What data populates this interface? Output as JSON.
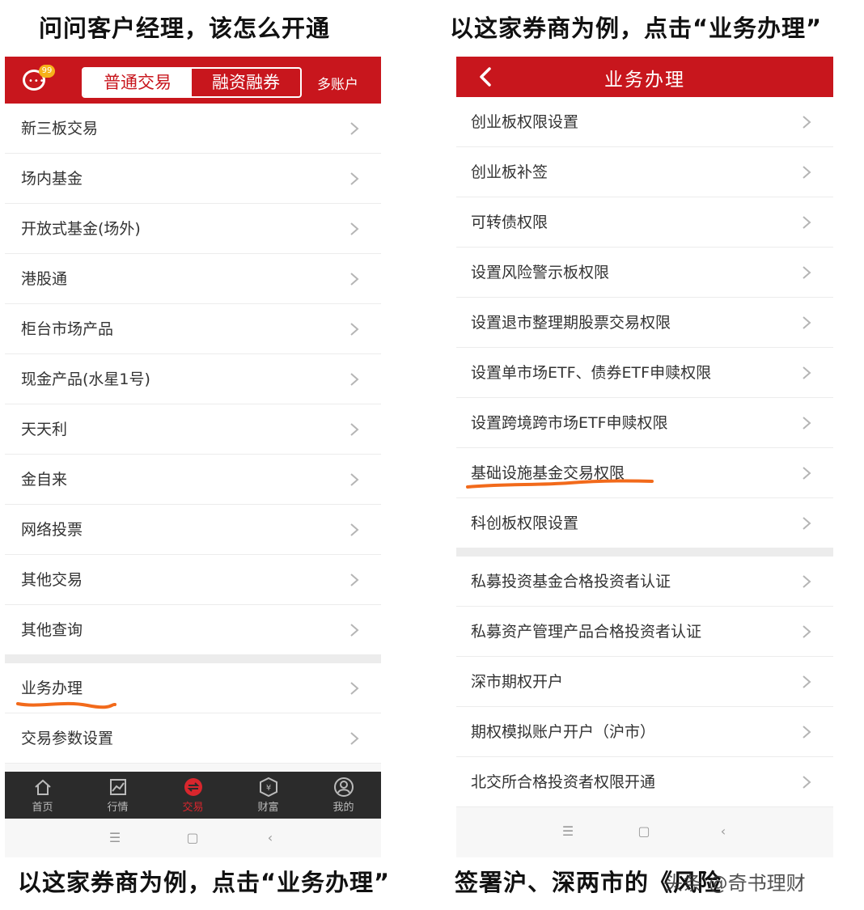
{
  "captions": {
    "top_left": "问问客户经理，该怎么开通",
    "top_right": "以这家券商为例，点击“业务办理”",
    "bottom_left": "以这家券商为例，点击“业务办理”",
    "bottom_right": "签署沪、深两市的《风险"
  },
  "watermark": "头条 @奇书理财",
  "left_screen": {
    "badge_count": "99",
    "segments": [
      "普通交易",
      "融资融券"
    ],
    "active_segment": 0,
    "multi_account": "多账户",
    "menu_group1": [
      "新三板交易",
      "场内基金",
      "开放式基金(场外)",
      "港股通",
      "柜台市场产品",
      "现金产品(水星1号)",
      "天天利",
      "金自来",
      "网络投票",
      "其他交易",
      "其他查询"
    ],
    "menu_group2": [
      "业务办理",
      "交易参数设置"
    ],
    "highlighted_item": "业务办理",
    "tabs": [
      {
        "label": "首页",
        "icon": "home-icon"
      },
      {
        "label": "行情",
        "icon": "chart-icon"
      },
      {
        "label": "交易",
        "icon": "trade-icon"
      },
      {
        "label": "财富",
        "icon": "wealth-icon"
      },
      {
        "label": "我的",
        "icon": "profile-icon"
      }
    ],
    "active_tab": "交易"
  },
  "right_screen": {
    "title": "业务办理",
    "group1": [
      "创业板权限设置",
      "创业板补签",
      "可转债权限",
      "设置风险警示板权限",
      "设置退市整理期股票交易权限",
      "设置单市场ETF、债券ETF申赎权限",
      "设置跨境跨市场ETF申赎权限",
      "基础设施基金交易权限",
      "科创板权限设置"
    ],
    "group2": [
      "私募投资基金合格投资者认证",
      "私募资产管理产品合格投资者认证",
      "深市期权开户",
      "期权模拟账户开户（沪市）",
      "北交所合格投资者权限开通"
    ],
    "highlighted_item": "基础设施基金交易权限"
  },
  "colors": {
    "brand_red": "#c8161d",
    "highlight_orange": "#f26a1b",
    "tabbar_bg": "#2b2b2b"
  }
}
